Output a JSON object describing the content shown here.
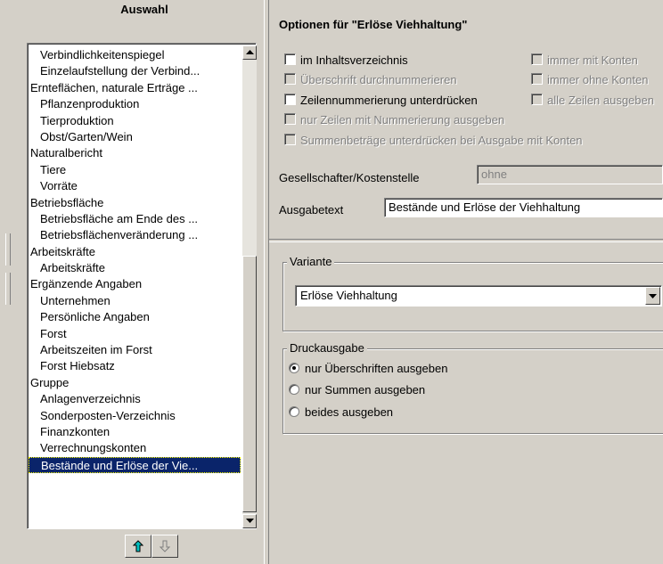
{
  "left": {
    "header": "Auswahl",
    "items": [
      {
        "label": "Verbindlichkeitenspiegel",
        "level": 1
      },
      {
        "label": "Einzelaufstellung der Verbind...",
        "level": 1
      },
      {
        "label": "Ernteflächen, naturale Erträge ...",
        "level": 0
      },
      {
        "label": "Pflanzenproduktion",
        "level": 1
      },
      {
        "label": "Tierproduktion",
        "level": 1
      },
      {
        "label": "Obst/Garten/Wein",
        "level": 1
      },
      {
        "label": "Naturalbericht",
        "level": 0
      },
      {
        "label": "Tiere",
        "level": 1
      },
      {
        "label": "Vorräte",
        "level": 1
      },
      {
        "label": "Betriebsfläche",
        "level": 0
      },
      {
        "label": "Betriebsfläche am Ende des ...",
        "level": 1
      },
      {
        "label": "Betriebsflächenveränderung ...",
        "level": 1
      },
      {
        "label": "Arbeitskräfte",
        "level": 0
      },
      {
        "label": "Arbeitskräfte",
        "level": 1
      },
      {
        "label": "Ergänzende Angaben",
        "level": 0
      },
      {
        "label": "Unternehmen",
        "level": 1
      },
      {
        "label": "Persönliche Angaben",
        "level": 1
      },
      {
        "label": "Forst",
        "level": 1
      },
      {
        "label": "Arbeitszeiten im Forst",
        "level": 1
      },
      {
        "label": "Forst Hiebsatz",
        "level": 1
      },
      {
        "label": "Gruppe",
        "level": 0
      },
      {
        "label": "Anlagenverzeichnis",
        "level": 1
      },
      {
        "label": "Sonderposten-Verzeichnis",
        "level": 1
      },
      {
        "label": "Finanzkonten",
        "level": 1
      },
      {
        "label": "Verrechnungskonten",
        "level": 1
      },
      {
        "label": "Bestände und Erlöse der Vie...",
        "level": 1,
        "selected": true
      }
    ],
    "move_up_icon": "arrow-up-icon",
    "move_down_icon": "arrow-down-icon"
  },
  "right": {
    "title": "Optionen für \"Erlöse Viehhaltung\"",
    "checkboxes": [
      {
        "label": "im Inhaltsverzeichnis",
        "checked": false,
        "enabled": true
      },
      {
        "label": "immer mit Konten",
        "checked": false,
        "enabled": false
      },
      {
        "label": "Überschrift durchnummerieren",
        "checked": false,
        "enabled": false
      },
      {
        "label": "immer ohne Konten",
        "checked": false,
        "enabled": false
      },
      {
        "label": "Zeilennummerierung unterdrücken",
        "checked": false,
        "enabled": true
      },
      {
        "label": "alle Zeilen ausgeben",
        "checked": false,
        "enabled": false
      },
      {
        "label": "nur Zeilen mit Nummerierung ausgeben",
        "checked": false,
        "enabled": false
      },
      {
        "label": "Summenbeträge unterdrücken bei Ausgabe mit Konten",
        "checked": false,
        "enabled": false
      }
    ],
    "gesellschafter_label": "Gesellschafter/Kostenstelle",
    "gesellschafter_value": "ohne",
    "ausgabetext_label": "Ausgabetext",
    "ausgabetext_value": "Bestände und Erlöse der Viehhaltung",
    "variante": {
      "title": "Variante",
      "selected": "Erlöse Viehhaltung"
    },
    "druckausgabe": {
      "title": "Druckausgabe",
      "options": [
        {
          "label": "nur Überschriften ausgeben",
          "selected": true
        },
        {
          "label": "nur Summen ausgeben",
          "selected": false
        },
        {
          "label": "beides ausgeben",
          "selected": false
        }
      ]
    }
  }
}
